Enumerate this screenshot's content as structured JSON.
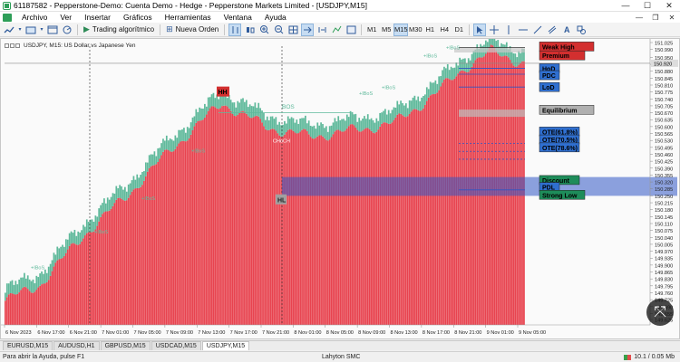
{
  "window": {
    "title": "61187582 - Pepperstone-Demo: Cuenta Demo - Hedge - Pepperstone Markets Limited - [USDJPY,M15]",
    "controls": [
      "—",
      "☐",
      "✕"
    ]
  },
  "menu": {
    "items": [
      "Archivo",
      "Ver",
      "Insertar",
      "Gráficos",
      "Herramientas",
      "Ventana",
      "Ayuda"
    ],
    "mdi_controls": [
      "—",
      "❐",
      "✕"
    ]
  },
  "toolbar": {
    "algo_trading_label": "Trading algorítmico",
    "new_order_label": "Nueva Orden",
    "timeframes": [
      "M1",
      "M5",
      "M15",
      "M30",
      "H1",
      "H4",
      "D1"
    ],
    "active_timeframe": "M15"
  },
  "chart": {
    "symbol_line": "USDJPY, M15:  US Dollar vs Japanese Yen",
    "price_ticks": [
      "151.025",
      "150.990",
      "150.950",
      "150.915",
      "150.880",
      "150.845",
      "150.810",
      "150.775",
      "150.740",
      "150.705",
      "150.670",
      "150.635",
      "150.600",
      "150.565",
      "150.530",
      "150.495",
      "150.460",
      "150.425",
      "150.390",
      "150.355",
      "150.320",
      "150.285",
      "150.250",
      "150.215",
      "150.180",
      "150.145",
      "150.110",
      "150.075",
      "150.040",
      "150.005",
      "149.970",
      "149.935",
      "149.900",
      "149.865",
      "149.830",
      "149.795",
      "149.760",
      "149.725",
      "149.690",
      "149.655",
      "149.625"
    ],
    "current_price": "150.920",
    "time_ticks": [
      "6 Nov 2023",
      "6 Nov 17:00",
      "6 Nov 21:00",
      "7 Nov 01:00",
      "7 Nov 05:00",
      "7 Nov 09:00",
      "7 Nov 13:00",
      "7 Nov 17:00",
      "7 Nov 21:00",
      "8 Nov 01:00",
      "8 Nov 05:00",
      "8 Nov 09:00",
      "8 Nov 13:00",
      "8 Nov 17:00",
      "8 Nov 21:00",
      "9 Nov 01:00",
      "9 Nov 05:00"
    ],
    "labels": {
      "weak_high": "Weak High",
      "premium": "Premium",
      "hod": "HoD",
      "pdc": "PDC",
      "lod": "LoD",
      "equilibrium": "Equilibrium",
      "ote618": "OTE(61.8%)",
      "ote705": "OTE(70.5%)",
      "ote786": "OTE(78.6%)",
      "discount": "Discount",
      "pdl": "PDL",
      "strong_low": "Strong Low",
      "hh": "HH",
      "hl": "HL",
      "bos": "BOS",
      "ibos": "+IBoS",
      "choch": "CHoCH"
    },
    "colors": {
      "bull": "#e8434f",
      "bear": "#5fb99b",
      "discount_zone": "#2f55c4",
      "premium_label": "#d32f2f",
      "label_blue": "#2f6fd0",
      "label_green": "#1e8c5a",
      "label_gray": "#b0b0b0"
    }
  },
  "tabs": {
    "items": [
      "EURUSD,M15",
      "AUDUSD,H1",
      "GBPUSD,M15",
      "USDCAD,M15",
      "USDJPY,M15"
    ],
    "active": "USDJPY,M15"
  },
  "status": {
    "help": "Para abrir la Ayuda, pulse F1",
    "profile": "Lahyton SMC",
    "traffic": "10.1 / 0.05 Mb"
  },
  "icons": [
    "app-icon",
    "new-chart-icon",
    "open-icon",
    "bar-chart-icon",
    "candles-icon",
    "line-chart-icon",
    "zoom-in-icon",
    "zoom-out-icon",
    "grid-icon",
    "autoscroll-icon",
    "chart-shift-icon",
    "cursor-icon",
    "crosshair-icon",
    "vertical-line-icon",
    "horizontal-line-icon",
    "trendline-icon",
    "channel-icon",
    "text-icon",
    "shapes-icon",
    "indicators-icon",
    "zoom-move-icon"
  ]
}
